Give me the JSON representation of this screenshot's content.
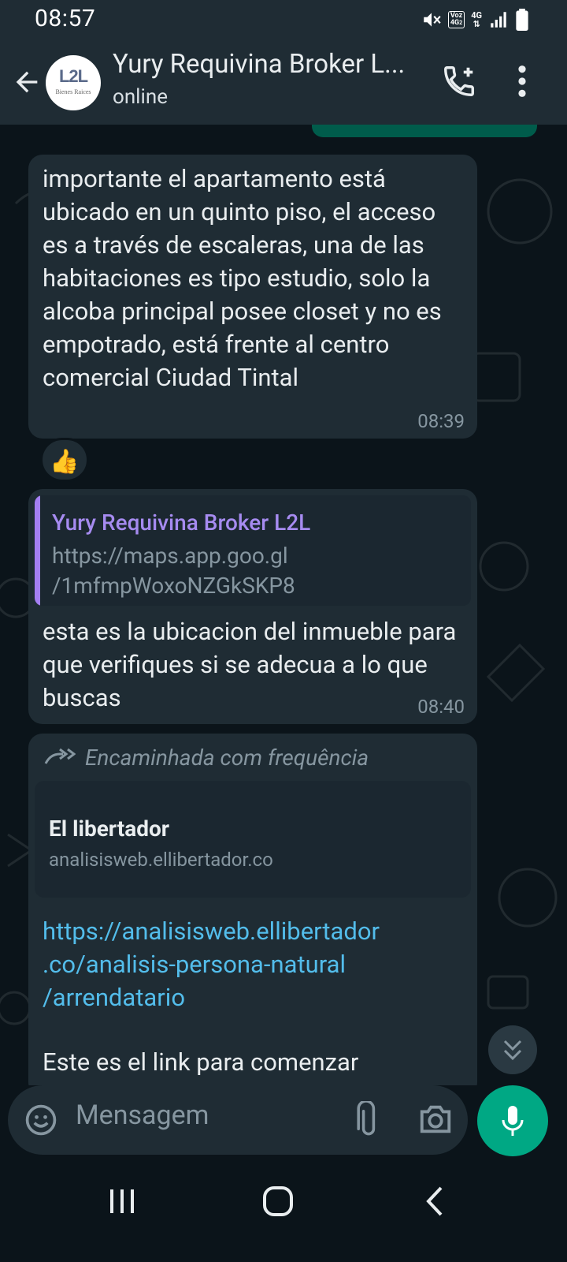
{
  "status_bar": {
    "time": "08:57",
    "volte_top": "Voz",
    "volte_bottom": "4G",
    "volte_sub": "2",
    "net": "4G"
  },
  "header": {
    "contact_name": "Yury Requivina Broker L...",
    "status": "online",
    "avatar_logo": "L2L",
    "avatar_subtitle": "Bienes Raices"
  },
  "messages": [
    {
      "text": "importante el apartamento está ubicado en un quinto piso, el acceso es a través de escaleras, una de las habitaciones es tipo estudio, solo la alcoba principal posee closet y no es empotrado, está frente al centro comercial Ciudad Tintal",
      "time": "08:39",
      "reaction": "👍"
    },
    {
      "quoted_author": "Yury Requivina Broker L2L",
      "quoted_text_line1": "https://maps.app.goo.gl",
      "quoted_text_line2": "/1mfmpWoxoNZGkSKP8",
      "text": "esta es la ubicacion del inmueble para que verifiques si se adecua a lo que buscas",
      "time": "08:40"
    },
    {
      "forwarded_label": "Encaminhada com frequência",
      "link_title": "El libertador",
      "link_domain": "analisisweb.ellibertador.co",
      "url_line1": "https://analisisweb.ellibertador",
      "url_line2": ".co/analisis-persona-natural",
      "url_line3": "/arrendatario",
      "text_partial": "Este es el link para comenzar"
    }
  ],
  "composer": {
    "placeholder": "Mensagem"
  },
  "colors": {
    "header": "#1f2c34",
    "bubble_in": "#1f2c34",
    "accent": "#00a884",
    "link": "#53bdeb",
    "quote_author": "#a68bf0"
  }
}
